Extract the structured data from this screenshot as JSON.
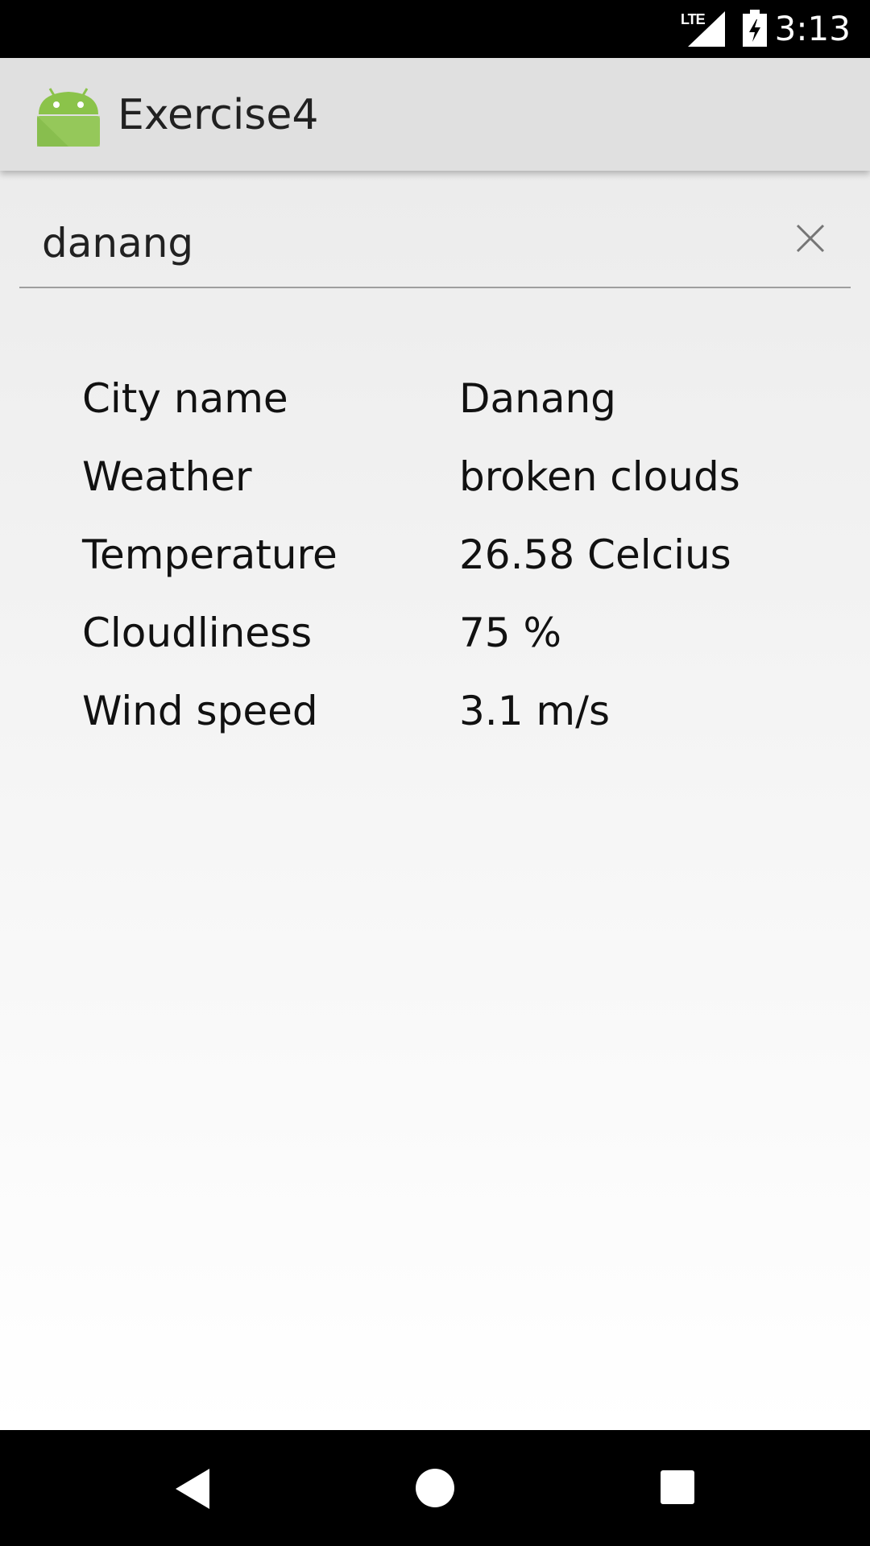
{
  "status_bar": {
    "time": "3:13",
    "network_label": "LTE",
    "signal_icon": "cell-signal-icon",
    "battery_icon": "battery-charging-icon"
  },
  "app_bar": {
    "title": "Exercise4",
    "logo_icon": "android-logo-icon"
  },
  "search": {
    "value": "danang",
    "clear_icon": "close-icon"
  },
  "weather": {
    "rows": [
      {
        "label": "City name",
        "value": "Danang"
      },
      {
        "label": "Weather",
        "value": "broken clouds"
      },
      {
        "label": "Temperature",
        "value": "26.58 Celcius"
      },
      {
        "label": "Cloudliness",
        "value": "75 %"
      },
      {
        "label": "Wind speed",
        "value": "3.1 m/s"
      }
    ]
  },
  "nav_bar": {
    "back_icon": "back-triangle-icon",
    "home_icon": "home-circle-icon",
    "recents_icon": "recents-square-icon"
  },
  "colors": {
    "app_bar": "#e0e0e0",
    "android_green": "#8bc34a",
    "text": "#212121"
  }
}
